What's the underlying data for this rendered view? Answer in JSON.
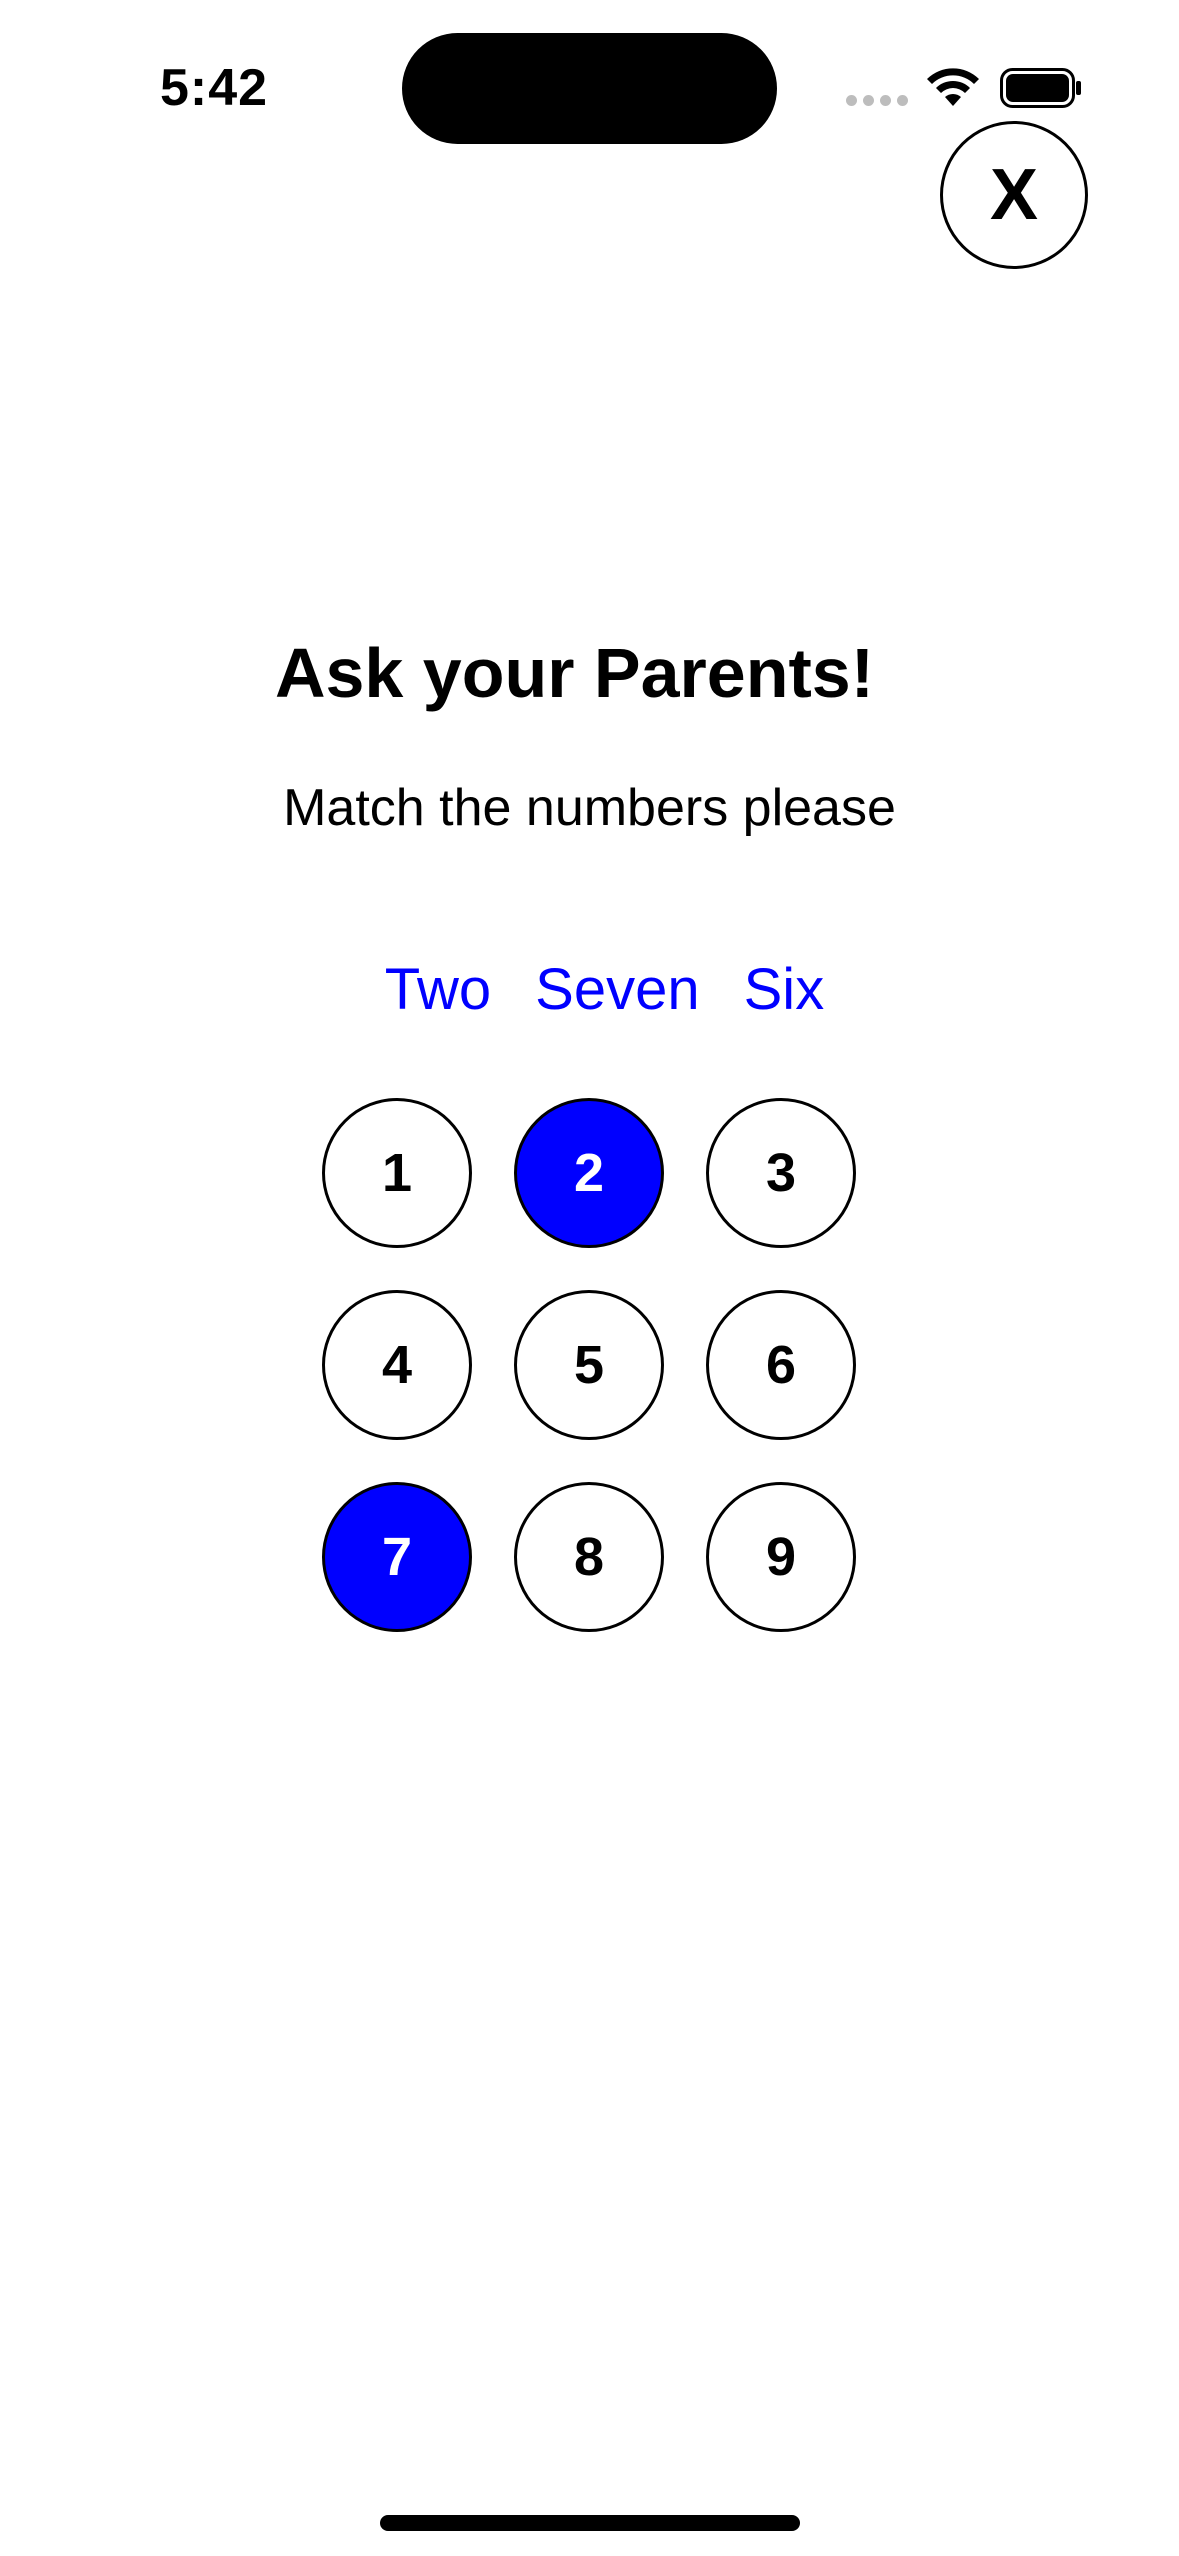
{
  "status_bar": {
    "time": "5:42",
    "icons": [
      "cellular-signal-icon",
      "wifi-icon",
      "battery-icon"
    ]
  },
  "close_button": {
    "label": "X"
  },
  "title": "Ask your Parents!",
  "subtitle": "Match the numbers please",
  "words": [
    "Two",
    "Seven",
    "Six"
  ],
  "keypad": {
    "keys": [
      "1",
      "2",
      "3",
      "4",
      "5",
      "6",
      "7",
      "8",
      "9"
    ],
    "selected": [
      "2",
      "7"
    ]
  },
  "colors": {
    "accent": "#0000ff",
    "background": "#ffffff",
    "text": "#000000"
  }
}
